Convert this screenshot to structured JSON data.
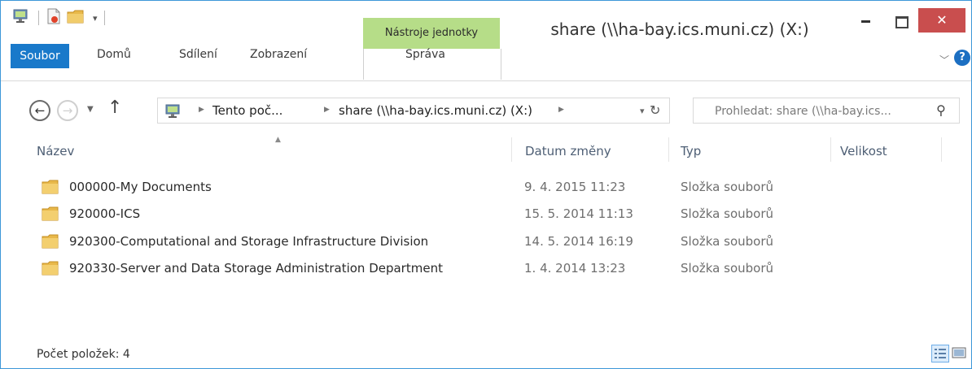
{
  "window": {
    "title": "share (\\\\ha-bay.ics.muni.cz) (X:)",
    "contextual_tab_title": "Nástroje jednotky",
    "close_label": "✕"
  },
  "ribbon": {
    "tabs": {
      "file": "Soubor",
      "home": "Domů",
      "share": "Sdílení",
      "view": "Zobrazení",
      "manage": "Správa"
    },
    "help_label": "?"
  },
  "address": {
    "crumbs": [
      "Tento poč...",
      "share (\\\\ha-bay.ics.muni.cz) (X:)"
    ]
  },
  "search": {
    "placeholder": "Prohledat: share (\\\\ha-bay.ics..."
  },
  "columns": {
    "name": "Název",
    "date": "Datum změny",
    "type": "Typ",
    "size": "Velikost"
  },
  "files": [
    {
      "name": "000000-My Documents",
      "date": "9. 4. 2015 11:23",
      "type": "Složka souborů"
    },
    {
      "name": "920000-ICS",
      "date": "15. 5. 2014 11:13",
      "type": "Složka souborů"
    },
    {
      "name": "920300-Computational and Storage Infrastructure Division",
      "date": "14. 5. 2014 16:19",
      "type": "Složka souborů"
    },
    {
      "name": "920330-Server and Data Storage Administration Department",
      "date": "1. 4. 2014 13:23",
      "type": "Složka souborů"
    }
  ],
  "status": {
    "item_count": "Počet položek: 4"
  },
  "colors": {
    "accent": "#1979ca",
    "contextual_tab": "#b6dd88",
    "close_button": "#c94e4e",
    "folder": "#e8b84a"
  },
  "icons": {
    "computer": "computer-icon",
    "folder": "folder-icon",
    "search": "search-icon",
    "refresh": "refresh-icon",
    "back": "back-arrow-icon",
    "forward": "forward-arrow-icon",
    "up": "up-arrow-icon"
  }
}
